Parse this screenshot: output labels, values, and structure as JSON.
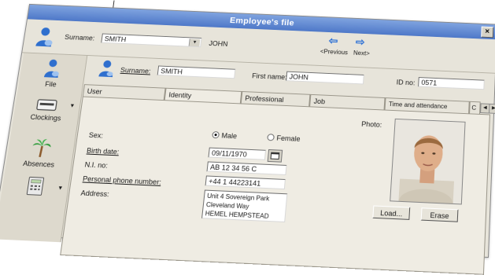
{
  "window": {
    "title": "Employee's file"
  },
  "header": {
    "surname_label": "Surname:",
    "surname_value": "SMITH",
    "firstname_value": "JOHN",
    "previous_label": "Previous",
    "next_label": "Next"
  },
  "sidebar": {
    "items": [
      {
        "label": "File",
        "icon": "person-icon"
      },
      {
        "label": "Clockings",
        "icon": "time-clock-icon"
      },
      {
        "label": "Absences",
        "icon": "palm-tree-icon"
      },
      {
        "label": "",
        "icon": "calculator-icon"
      }
    ]
  },
  "record": {
    "surname_label": "Surname:",
    "surname_value": "SMITH",
    "firstname_label": "First name:",
    "firstname_value": "JOHN",
    "id_label": "ID no:",
    "id_value": "0571"
  },
  "tabs": [
    "User",
    "Identity",
    "Professional",
    "Job",
    "Time and attendance",
    "C"
  ],
  "identity": {
    "sex_label": "Sex:",
    "male_label": "Male",
    "female_label": "Female",
    "birth_label": "Birth date:",
    "birth_value": "09/11/1970",
    "ni_label": "N.I. no:",
    "ni_value": "AB 12 34 56 C",
    "phone_label": "Personal phone number:",
    "phone_value": "+44 1 44223141",
    "address_label": "Address:",
    "address_lines": [
      "Unit 4 Sovereign Park",
      "Cleveland Way",
      "HEMEL HEMPSTEAD"
    ],
    "photo_label": "Photo:"
  },
  "buttons": {
    "load": "Load...",
    "erase": "Erase"
  }
}
